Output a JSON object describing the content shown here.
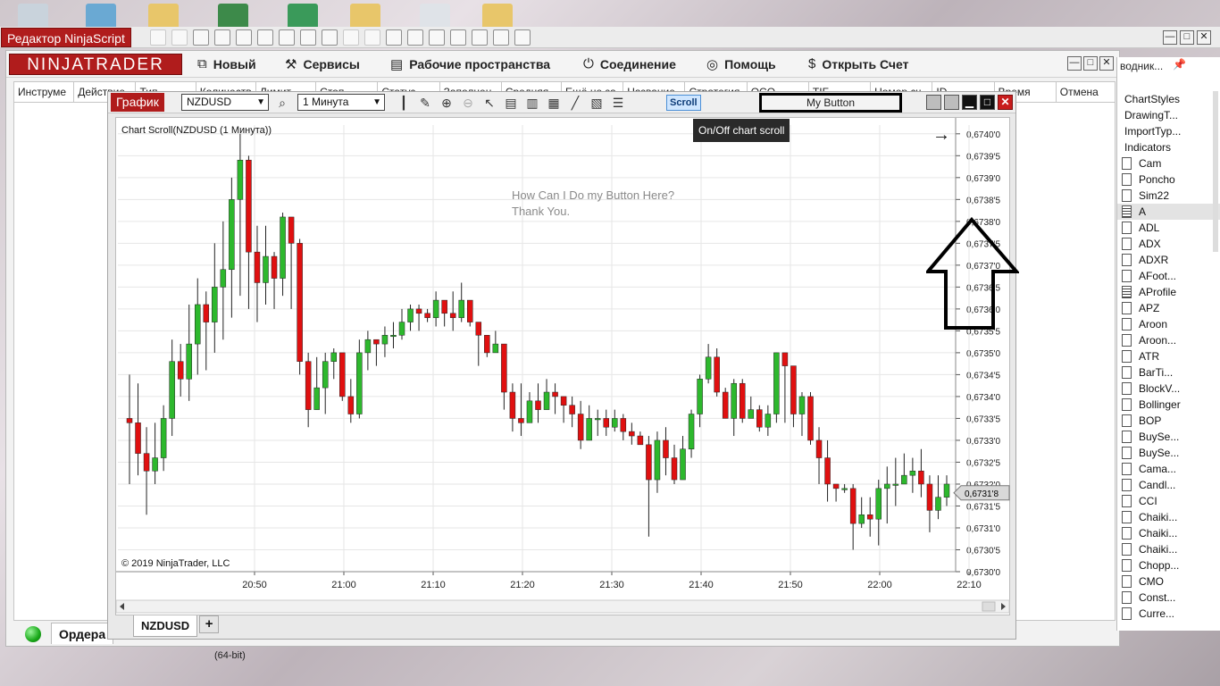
{
  "ns_editor": {
    "title": "Редактор NinjaScript",
    "win_buttons": [
      "—",
      "□",
      "✕"
    ]
  },
  "control_center": {
    "logo": "NINJATRADER",
    "menus": [
      {
        "icon": "new-icon",
        "glyph": "⧉",
        "label": "Новый"
      },
      {
        "icon": "tools-icon",
        "glyph": "⚒",
        "label": "Сервисы"
      },
      {
        "icon": "workspace-icon",
        "glyph": "▤",
        "label": "Рабочие пространства"
      },
      {
        "icon": "connection-icon",
        "glyph": "⏻",
        "label": "Соединение"
      },
      {
        "icon": "help-icon",
        "glyph": "◎",
        "label": "Помощь"
      },
      {
        "icon": "dollar-icon",
        "glyph": "$",
        "label": "Открыть Счет"
      }
    ],
    "win_buttons": [
      "—",
      "□",
      "✕"
    ],
    "orders_columns": [
      "Инструме",
      "Действие",
      "Тип",
      "Количеств",
      "Лимит",
      "Стоп",
      "Статус",
      "Заполнен",
      "Средняя",
      "Ещё не за",
      "Название",
      "Стратегия",
      "OCO",
      "TIF",
      "Номер сч",
      "ID",
      "Время",
      "Отмена"
    ],
    "orders_tab": "Ордера"
  },
  "explorer": {
    "title": "водник...",
    "items": [
      {
        "label": "ChartStyles",
        "kind": "folder"
      },
      {
        "label": "DrawingT...",
        "kind": "folder"
      },
      {
        "label": "ImportTyp...",
        "kind": "folder"
      },
      {
        "label": "Indicators",
        "kind": "folder"
      },
      {
        "label": "Cam",
        "kind": "doc"
      },
      {
        "label": "Poncho",
        "kind": "doc"
      },
      {
        "label": "Sim22",
        "kind": "doc"
      },
      {
        "label": "A",
        "kind": "lined",
        "selected": true
      },
      {
        "label": "ADL",
        "kind": "doc"
      },
      {
        "label": "ADX",
        "kind": "doc"
      },
      {
        "label": "ADXR",
        "kind": "doc"
      },
      {
        "label": "AFoot...",
        "kind": "doc"
      },
      {
        "label": "AProfile",
        "kind": "lined"
      },
      {
        "label": "APZ",
        "kind": "doc"
      },
      {
        "label": "Aroon",
        "kind": "doc"
      },
      {
        "label": "Aroon...",
        "kind": "doc"
      },
      {
        "label": "ATR",
        "kind": "doc"
      },
      {
        "label": "BarTi...",
        "kind": "doc"
      },
      {
        "label": "BlockV...",
        "kind": "doc"
      },
      {
        "label": "Bollinger",
        "kind": "doc"
      },
      {
        "label": "BOP",
        "kind": "doc"
      },
      {
        "label": "BuySe...",
        "kind": "doc"
      },
      {
        "label": "BuySe...",
        "kind": "doc"
      },
      {
        "label": "Cama...",
        "kind": "doc"
      },
      {
        "label": "Candl...",
        "kind": "doc"
      },
      {
        "label": "CCI",
        "kind": "doc"
      },
      {
        "label": "Chaiki...",
        "kind": "doc"
      },
      {
        "label": "Chaiki...",
        "kind": "doc"
      },
      {
        "label": "Chaiki...",
        "kind": "doc"
      },
      {
        "label": "Chopp...",
        "kind": "doc"
      },
      {
        "label": "CMO",
        "kind": "doc"
      },
      {
        "label": "Const...",
        "kind": "doc"
      },
      {
        "label": "Curre...",
        "kind": "doc"
      }
    ]
  },
  "chart_window": {
    "title": "График",
    "instrument": "NZDUSD",
    "interval": "1 Минута",
    "scroll_label": "Scroll",
    "my_button_label": "My Button",
    "tooltip": "On/Off chart scroll",
    "chart_label": "Chart Scroll(NZDUSD (1 Минута))",
    "copyright": "© 2019 NinjaTrader, LLC",
    "question_line1": "How Can I Do my Button Here?",
    "question_line2": "Thank You.",
    "nav_arrow": "→",
    "tab_label": "NZDUSD",
    "tab_add": "+",
    "current_price_label": "0,6731'8"
  },
  "colors": {
    "brand_red": "#b01c1c",
    "up_candle": "#2db82d",
    "down_candle": "#e01010",
    "grid": "#e6e6e6"
  },
  "taskbar_text": "(64-bit)",
  "chart_data": {
    "type": "candlestick",
    "x_ticks": [
      "20:50",
      "21:00",
      "21:10",
      "21:20",
      "21:30",
      "21:40",
      "21:50",
      "22:00",
      "22:10"
    ],
    "y_ticks": [
      "0,6740'0",
      "0,6739'5",
      "0,6739'0",
      "0,6738'5",
      "0,6738'0",
      "0,6737'5",
      "0,6737'0",
      "0,6736'5",
      "0,6736'0",
      "0,6735'5",
      "0,6735'0",
      "0,6734'5",
      "0,6734'0",
      "0,6733'5",
      "0,6733'0",
      "0,6732'5",
      "0,6732'0",
      "0,6731'5",
      "0,6731'0",
      "0,6730'5",
      "0,6730'0"
    ],
    "ylim": [
      0.673,
      0.67402
    ],
    "current_price": 0.67318,
    "candles": [
      [
        0.67335,
        0.67334,
        0.67345,
        0.6732
      ],
      [
        0.67334,
        0.67327,
        0.67343,
        0.67322
      ],
      [
        0.67327,
        0.67323,
        0.67333,
        0.67313
      ],
      [
        0.67323,
        0.67326,
        0.67334,
        0.6732
      ],
      [
        0.67326,
        0.67335,
        0.67338,
        0.67323
      ],
      [
        0.67335,
        0.67348,
        0.67353,
        0.67331
      ],
      [
        0.67348,
        0.67344,
        0.67352,
        0.6734
      ],
      [
        0.67344,
        0.67352,
        0.67361,
        0.67339
      ],
      [
        0.67352,
        0.67361,
        0.67367,
        0.67345
      ],
      [
        0.67361,
        0.67357,
        0.67364,
        0.67346
      ],
      [
        0.67357,
        0.67365,
        0.67375,
        0.6735
      ],
      [
        0.67365,
        0.67369,
        0.6738,
        0.67353
      ],
      [
        0.67369,
        0.67385,
        0.6739,
        0.67358
      ],
      [
        0.67385,
        0.67394,
        0.674,
        0.67363
      ],
      [
        0.67394,
        0.67373,
        0.67395,
        0.6736
      ],
      [
        0.67373,
        0.67366,
        0.67379,
        0.67357
      ],
      [
        0.67366,
        0.67372,
        0.67379,
        0.67361
      ],
      [
        0.67372,
        0.67367,
        0.67373,
        0.6736
      ],
      [
        0.67367,
        0.67381,
        0.67382,
        0.67363
      ],
      [
        0.67381,
        0.67375,
        0.67376,
        0.6736
      ],
      [
        0.67375,
        0.67348,
        0.67376,
        0.67345
      ],
      [
        0.67348,
        0.67337,
        0.6735,
        0.67333
      ],
      [
        0.67337,
        0.67342,
        0.67349,
        0.67337
      ],
      [
        0.67342,
        0.67348,
        0.6735,
        0.67336
      ],
      [
        0.67348,
        0.6735,
        0.67351,
        0.67344
      ],
      [
        0.6735,
        0.6734,
        0.67345,
        0.67339
      ],
      [
        0.6734,
        0.67336,
        0.67344,
        0.67334
      ],
      [
        0.67336,
        0.6735,
        0.67353,
        0.67335
      ],
      [
        0.6735,
        0.67353,
        0.67355,
        0.67346
      ],
      [
        0.67353,
        0.67352,
        0.67353,
        0.67347
      ],
      [
        0.67352,
        0.67354,
        0.67356,
        0.67349
      ],
      [
        0.67354,
        0.67354,
        0.67357,
        0.67351
      ],
      [
        0.67354,
        0.67357,
        0.6736,
        0.67353
      ],
      [
        0.67357,
        0.6736,
        0.67361,
        0.67355
      ],
      [
        0.6736,
        0.67359,
        0.67361,
        0.67355
      ],
      [
        0.67359,
        0.67358,
        0.6736,
        0.67357
      ],
      [
        0.67358,
        0.67362,
        0.67364,
        0.67356
      ],
      [
        0.67362,
        0.67359,
        0.6736,
        0.67356
      ],
      [
        0.67359,
        0.67358,
        0.67364,
        0.67355
      ],
      [
        0.67358,
        0.67362,
        0.67366,
        0.67357
      ],
      [
        0.67362,
        0.67357,
        0.67359,
        0.67356
      ],
      [
        0.67357,
        0.67354,
        0.67355,
        0.67347
      ],
      [
        0.67354,
        0.6735,
        0.67353,
        0.67349
      ],
      [
        0.6735,
        0.67352,
        0.67355,
        0.67351
      ],
      [
        0.67352,
        0.67341,
        0.67352,
        0.67337
      ],
      [
        0.67341,
        0.67335,
        0.67343,
        0.67332
      ],
      [
        0.67335,
        0.67334,
        0.67343,
        0.67331
      ],
      [
        0.67334,
        0.67339,
        0.67341,
        0.67336
      ],
      [
        0.67339,
        0.67337,
        0.67343,
        0.67334
      ],
      [
        0.67337,
        0.67341,
        0.67344,
        0.67337
      ],
      [
        0.67341,
        0.6734,
        0.67343,
        0.67336
      ],
      [
        0.6734,
        0.67338,
        0.6734,
        0.67334
      ],
      [
        0.67338,
        0.67336,
        0.6734,
        0.67333
      ],
      [
        0.67336,
        0.6733,
        0.67339,
        0.67328
      ],
      [
        0.6733,
        0.67335,
        0.67338,
        0.6733
      ],
      [
        0.67335,
        0.67335,
        0.67337,
        0.67331
      ],
      [
        0.67335,
        0.67333,
        0.67337,
        0.67331
      ],
      [
        0.67333,
        0.67335,
        0.67337,
        0.67332
      ],
      [
        0.67335,
        0.67332,
        0.67336,
        0.6733
      ],
      [
        0.67332,
        0.67331,
        0.67334,
        0.67329
      ],
      [
        0.67331,
        0.67329,
        0.67332,
        0.67329
      ],
      [
        0.67329,
        0.67321,
        0.67331,
        0.67308
      ],
      [
        0.67321,
        0.6733,
        0.67332,
        0.67318
      ],
      [
        0.6733,
        0.67326,
        0.67333,
        0.67322
      ],
      [
        0.67326,
        0.67321,
        0.67329,
        0.6732
      ],
      [
        0.67321,
        0.67328,
        0.67331,
        0.67321
      ],
      [
        0.67328,
        0.67336,
        0.67337,
        0.67326
      ],
      [
        0.67336,
        0.67344,
        0.67345,
        0.67333
      ],
      [
        0.67344,
        0.67349,
        0.67352,
        0.67343
      ],
      [
        0.67349,
        0.67341,
        0.67351,
        0.6734
      ],
      [
        0.67341,
        0.67335,
        0.67342,
        0.67335
      ],
      [
        0.67335,
        0.67343,
        0.67344,
        0.67331
      ],
      [
        0.67343,
        0.67335,
        0.67344,
        0.67334
      ],
      [
        0.67335,
        0.67337,
        0.6734,
        0.67336
      ],
      [
        0.67337,
        0.67333,
        0.67338,
        0.67332
      ],
      [
        0.67333,
        0.67336,
        0.67338,
        0.67331
      ],
      [
        0.67336,
        0.6735,
        0.6735,
        0.67334
      ],
      [
        0.6735,
        0.67347,
        0.6735,
        0.67334
      ],
      [
        0.67347,
        0.67336,
        0.67342,
        0.67333
      ],
      [
        0.67336,
        0.6734,
        0.67341,
        0.67331
      ],
      [
        0.6734,
        0.6733,
        0.67341,
        0.67329
      ],
      [
        0.6733,
        0.67326,
        0.67333,
        0.6732
      ],
      [
        0.67326,
        0.6732,
        0.6733,
        0.67316
      ],
      [
        0.6732,
        0.67319,
        0.6732,
        0.67316
      ],
      [
        0.67319,
        0.67319,
        0.6732,
        0.67318
      ],
      [
        0.67319,
        0.67311,
        0.6732,
        0.67305
      ],
      [
        0.67311,
        0.67313,
        0.67317,
        0.6731
      ],
      [
        0.67313,
        0.67312,
        0.67317,
        0.67308
      ],
      [
        0.67312,
        0.67319,
        0.67321,
        0.67306
      ],
      [
        0.67319,
        0.6732,
        0.67324,
        0.67311
      ],
      [
        0.6732,
        0.6732,
        0.67326,
        0.67315
      ],
      [
        0.6732,
        0.67322,
        0.67327,
        0.6732
      ],
      [
        0.67322,
        0.67323,
        0.67326,
        0.67318
      ],
      [
        0.67323,
        0.6732,
        0.67328,
        0.67317
      ],
      [
        0.6732,
        0.67314,
        0.67322,
        0.67309
      ],
      [
        0.67314,
        0.67317,
        0.67322,
        0.67312
      ],
      [
        0.67317,
        0.6732,
        0.67322,
        0.67315
      ]
    ]
  }
}
